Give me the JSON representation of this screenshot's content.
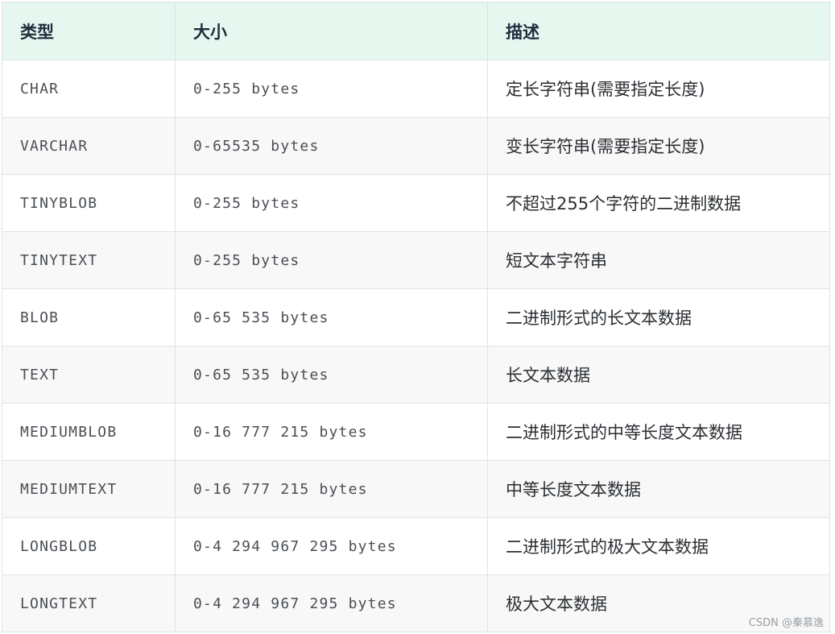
{
  "table": {
    "headers": [
      "类型",
      "大小",
      "描述"
    ],
    "rows": [
      {
        "type": "CHAR",
        "size": "0-255 bytes",
        "desc": "定长字符串(需要指定长度)"
      },
      {
        "type": "VARCHAR",
        "size": "0-65535 bytes",
        "desc": "变长字符串(需要指定长度)"
      },
      {
        "type": "TINYBLOB",
        "size": "0-255 bytes",
        "desc": "不超过255个字符的二进制数据"
      },
      {
        "type": "TINYTEXT",
        "size": "0-255 bytes",
        "desc": "短文本字符串"
      },
      {
        "type": "BLOB",
        "size": "0-65 535 bytes",
        "desc": "二进制形式的长文本数据"
      },
      {
        "type": "TEXT",
        "size": "0-65 535 bytes",
        "desc": "长文本数据"
      },
      {
        "type": "MEDIUMBLOB",
        "size": "0-16 777 215 bytes",
        "desc": "二进制形式的中等长度文本数据"
      },
      {
        "type": "MEDIUMTEXT",
        "size": "0-16 777 215 bytes",
        "desc": "中等长度文本数据"
      },
      {
        "type": "LONGBLOB",
        "size": "0-4 294 967 295 bytes",
        "desc": "二进制形式的极大文本数据"
      },
      {
        "type": "LONGTEXT",
        "size": "0-4 294 967 295 bytes",
        "desc": "极大文本数据"
      }
    ]
  },
  "watermark": "CSDN @秦慕逸"
}
